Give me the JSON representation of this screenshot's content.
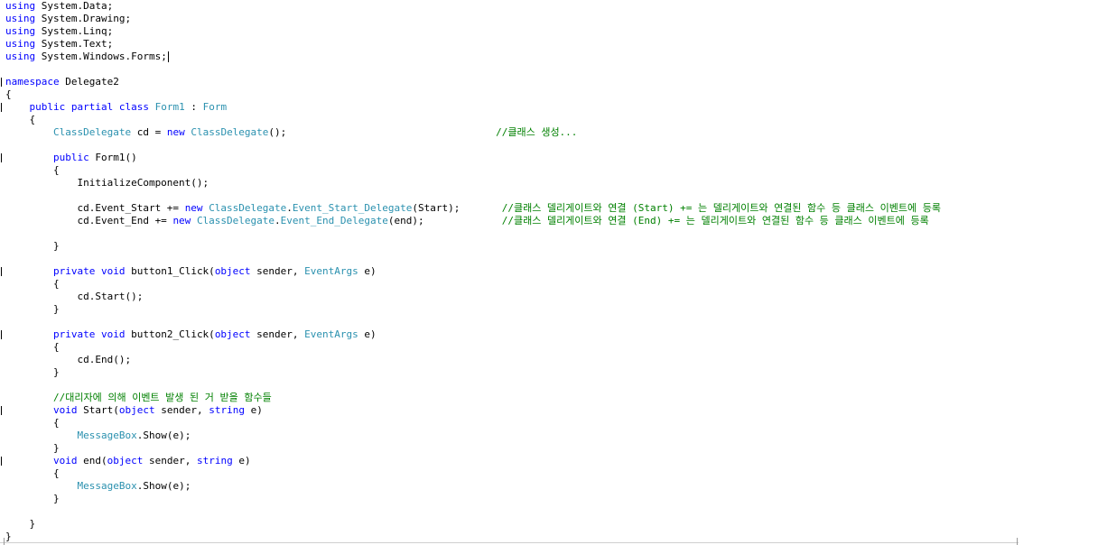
{
  "editor": {
    "language": "C#",
    "lines": [
      {
        "line": 1,
        "tokens": [
          {
            "k": "kw",
            "t": "using"
          },
          {
            "k": "tx",
            "t": " System.Data;"
          }
        ]
      },
      {
        "line": 2,
        "tokens": [
          {
            "k": "kw",
            "t": "using"
          },
          {
            "k": "tx",
            "t": " System.Drawing;"
          }
        ]
      },
      {
        "line": 3,
        "tokens": [
          {
            "k": "kw",
            "t": "using"
          },
          {
            "k": "tx",
            "t": " System.Linq;"
          }
        ]
      },
      {
        "line": 4,
        "tokens": [
          {
            "k": "kw",
            "t": "using"
          },
          {
            "k": "tx",
            "t": " System.Text;"
          }
        ]
      },
      {
        "line": 5,
        "tokens": [
          {
            "k": "kw",
            "t": "using"
          },
          {
            "k": "tx",
            "t": " System.Windows.Forms;"
          }
        ],
        "caret": true
      },
      {
        "line": 6,
        "tokens": []
      },
      {
        "line": 7,
        "tokens": [
          {
            "k": "kw",
            "t": "namespace"
          },
          {
            "k": "tx",
            "t": " Delegate2"
          }
        ]
      },
      {
        "line": 8,
        "tokens": [
          {
            "k": "tx",
            "t": "{"
          }
        ]
      },
      {
        "line": 9,
        "tokens": [
          {
            "k": "tx",
            "t": "    "
          },
          {
            "k": "kw",
            "t": "public"
          },
          {
            "k": "tx",
            "t": " "
          },
          {
            "k": "kw",
            "t": "partial"
          },
          {
            "k": "tx",
            "t": " "
          },
          {
            "k": "kw",
            "t": "class"
          },
          {
            "k": "tx",
            "t": " "
          },
          {
            "k": "ty",
            "t": "Form1"
          },
          {
            "k": "tx",
            "t": " : "
          },
          {
            "k": "ty",
            "t": "Form"
          }
        ]
      },
      {
        "line": 10,
        "tokens": [
          {
            "k": "tx",
            "t": "    {"
          }
        ]
      },
      {
        "line": 11,
        "tokens": [
          {
            "k": "tx",
            "t": "        "
          },
          {
            "k": "ty",
            "t": "ClassDelegate"
          },
          {
            "k": "tx",
            "t": " cd = "
          },
          {
            "k": "kw",
            "t": "new"
          },
          {
            "k": "tx",
            "t": " "
          },
          {
            "k": "ty",
            "t": "ClassDelegate"
          },
          {
            "k": "tx",
            "t": "();                                   "
          },
          {
            "k": "cm",
            "t": "//클래스 생성..."
          }
        ]
      },
      {
        "line": 12,
        "tokens": []
      },
      {
        "line": 13,
        "tokens": [
          {
            "k": "tx",
            "t": "        "
          },
          {
            "k": "kw",
            "t": "public"
          },
          {
            "k": "tx",
            "t": " Form1()"
          }
        ]
      },
      {
        "line": 14,
        "tokens": [
          {
            "k": "tx",
            "t": "        {"
          }
        ]
      },
      {
        "line": 15,
        "tokens": [
          {
            "k": "tx",
            "t": "            InitializeComponent();"
          }
        ]
      },
      {
        "line": 16,
        "tokens": []
      },
      {
        "line": 17,
        "tokens": [
          {
            "k": "tx",
            "t": "            cd.Event_Start += "
          },
          {
            "k": "kw",
            "t": "new"
          },
          {
            "k": "tx",
            "t": " "
          },
          {
            "k": "ty",
            "t": "ClassDelegate"
          },
          {
            "k": "tx",
            "t": "."
          },
          {
            "k": "ty",
            "t": "Event_Start_Delegate"
          },
          {
            "k": "tx",
            "t": "(Start);       "
          },
          {
            "k": "cm",
            "t": "//클래스 델리게이트와 연결 (Start) += 는 델리게이트와 연결된 함수 등 클래스 이벤트에 등록"
          }
        ]
      },
      {
        "line": 18,
        "tokens": [
          {
            "k": "tx",
            "t": "            cd.Event_End += "
          },
          {
            "k": "kw",
            "t": "new"
          },
          {
            "k": "tx",
            "t": " "
          },
          {
            "k": "ty",
            "t": "ClassDelegate"
          },
          {
            "k": "tx",
            "t": "."
          },
          {
            "k": "ty",
            "t": "Event_End_Delegate"
          },
          {
            "k": "tx",
            "t": "(end);             "
          },
          {
            "k": "cm",
            "t": "//클래스 델리게이트와 연결 (End) += 는 델리게이트와 연결된 함수 등 클래스 이벤트에 등록"
          }
        ]
      },
      {
        "line": 19,
        "tokens": []
      },
      {
        "line": 20,
        "tokens": [
          {
            "k": "tx",
            "t": "        }"
          }
        ]
      },
      {
        "line": 21,
        "tokens": []
      },
      {
        "line": 22,
        "tokens": [
          {
            "k": "tx",
            "t": "        "
          },
          {
            "k": "kw",
            "t": "private"
          },
          {
            "k": "tx",
            "t": " "
          },
          {
            "k": "kw",
            "t": "void"
          },
          {
            "k": "tx",
            "t": " button1_Click("
          },
          {
            "k": "kw",
            "t": "object"
          },
          {
            "k": "tx",
            "t": " sender, "
          },
          {
            "k": "ty",
            "t": "EventArgs"
          },
          {
            "k": "tx",
            "t": " e)"
          }
        ]
      },
      {
        "line": 23,
        "tokens": [
          {
            "k": "tx",
            "t": "        {"
          }
        ]
      },
      {
        "line": 24,
        "tokens": [
          {
            "k": "tx",
            "t": "            cd.Start();"
          }
        ]
      },
      {
        "line": 25,
        "tokens": [
          {
            "k": "tx",
            "t": "        }"
          }
        ]
      },
      {
        "line": 26,
        "tokens": []
      },
      {
        "line": 27,
        "tokens": [
          {
            "k": "tx",
            "t": "        "
          },
          {
            "k": "kw",
            "t": "private"
          },
          {
            "k": "tx",
            "t": " "
          },
          {
            "k": "kw",
            "t": "void"
          },
          {
            "k": "tx",
            "t": " button2_Click("
          },
          {
            "k": "kw",
            "t": "object"
          },
          {
            "k": "tx",
            "t": " sender, "
          },
          {
            "k": "ty",
            "t": "EventArgs"
          },
          {
            "k": "tx",
            "t": " e)"
          }
        ]
      },
      {
        "line": 28,
        "tokens": [
          {
            "k": "tx",
            "t": "        {"
          }
        ]
      },
      {
        "line": 29,
        "tokens": [
          {
            "k": "tx",
            "t": "            cd.End();"
          }
        ]
      },
      {
        "line": 30,
        "tokens": [
          {
            "k": "tx",
            "t": "        }"
          }
        ]
      },
      {
        "line": 31,
        "tokens": []
      },
      {
        "line": 32,
        "tokens": [
          {
            "k": "tx",
            "t": "        "
          },
          {
            "k": "cm",
            "t": "//대리자에 의해 이벤트 발생 된 거 받을 함수들"
          }
        ]
      },
      {
        "line": 33,
        "tokens": [
          {
            "k": "tx",
            "t": "        "
          },
          {
            "k": "kw",
            "t": "void"
          },
          {
            "k": "tx",
            "t": " Start("
          },
          {
            "k": "kw",
            "t": "object"
          },
          {
            "k": "tx",
            "t": " sender, "
          },
          {
            "k": "kw",
            "t": "string"
          },
          {
            "k": "tx",
            "t": " e)"
          }
        ]
      },
      {
        "line": 34,
        "tokens": [
          {
            "k": "tx",
            "t": "        {"
          }
        ]
      },
      {
        "line": 35,
        "tokens": [
          {
            "k": "tx",
            "t": "            "
          },
          {
            "k": "ty",
            "t": "MessageBox"
          },
          {
            "k": "tx",
            "t": ".Show(e);"
          }
        ]
      },
      {
        "line": 36,
        "tokens": [
          {
            "k": "tx",
            "t": "        }"
          }
        ]
      },
      {
        "line": 37,
        "tokens": [
          {
            "k": "tx",
            "t": "        "
          },
          {
            "k": "kw",
            "t": "void"
          },
          {
            "k": "tx",
            "t": " end("
          },
          {
            "k": "kw",
            "t": "object"
          },
          {
            "k": "tx",
            "t": " sender, "
          },
          {
            "k": "kw",
            "t": "string"
          },
          {
            "k": "tx",
            "t": " e)"
          }
        ]
      },
      {
        "line": 38,
        "tokens": [
          {
            "k": "tx",
            "t": "        {"
          }
        ]
      },
      {
        "line": 39,
        "tokens": [
          {
            "k": "tx",
            "t": "            "
          },
          {
            "k": "ty",
            "t": "MessageBox"
          },
          {
            "k": "tx",
            "t": ".Show(e);"
          }
        ]
      },
      {
        "line": 40,
        "tokens": [
          {
            "k": "tx",
            "t": "        }"
          }
        ]
      },
      {
        "line": 41,
        "tokens": []
      },
      {
        "line": 42,
        "tokens": [
          {
            "k": "tx",
            "t": "    }"
          }
        ]
      },
      {
        "line": 43,
        "tokens": [
          {
            "k": "tx",
            "t": "}"
          }
        ]
      }
    ]
  },
  "colors": {
    "keyword": "#0000ff",
    "type": "#2b91af",
    "comment": "#008000",
    "text": "#000000",
    "background": "#ffffff"
  }
}
